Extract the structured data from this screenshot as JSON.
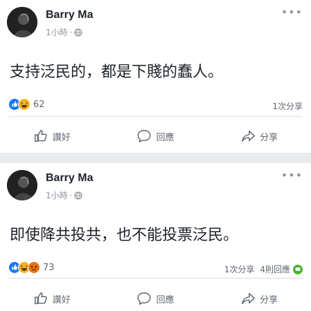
{
  "posts": [
    {
      "author": "Barry Ma",
      "time": "1小時",
      "separator": "·",
      "text": "支持泛民的，都是下賤的蠢人。",
      "reaction_count": "62",
      "shares": "1次分享",
      "comments": "",
      "actions": {
        "like": "讚好",
        "comment": "回應",
        "share": "分享"
      }
    },
    {
      "author": "Barry Ma",
      "time": "1小時",
      "separator": "·",
      "text": "即使降共投共，也不能投票泛民。",
      "reaction_count": "73",
      "shares": "1次分享",
      "comments": "4則回應",
      "actions": {
        "like": "讚好",
        "comment": "回應",
        "share": "分享"
      }
    }
  ],
  "colors": {
    "like_blue": "#1877f2",
    "haha_yellow": "#f7b125",
    "angry_orange": "#e9710f",
    "comment_green": "#44b62c",
    "background": "#e9ebee"
  },
  "icons": {
    "like": "thumbs-up-icon",
    "comment": "speech-bubble-icon",
    "share": "share-arrow-icon",
    "privacy": "globe-icon",
    "more": "more-dots-icon"
  }
}
